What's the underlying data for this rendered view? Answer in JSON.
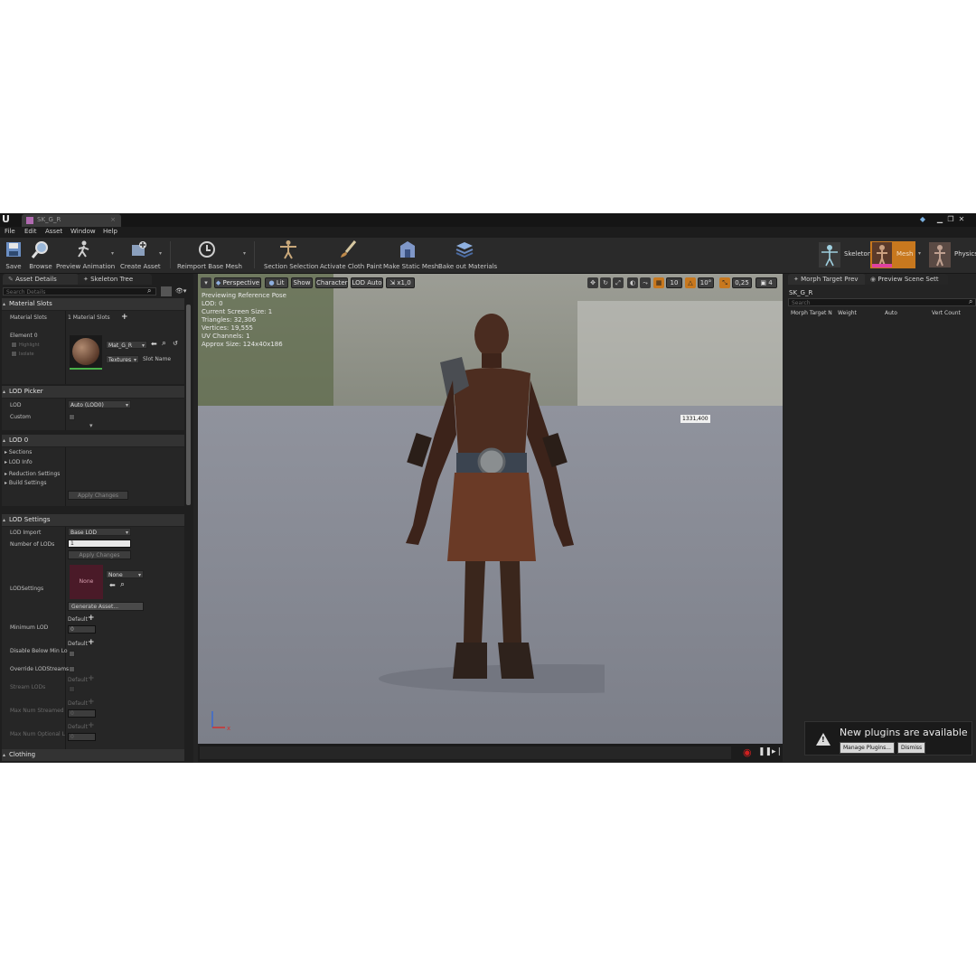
{
  "window": {
    "tab_title": "SK_G_R"
  },
  "menu": [
    "File",
    "Edit",
    "Asset",
    "Window",
    "Help"
  ],
  "toolbar": {
    "save": "Save",
    "browse": "Browse",
    "preview_animation": "Preview Animation",
    "create_asset": "Create Asset",
    "reimport_base_mesh": "Reimport Base Mesh",
    "section_selection": "Section Selection",
    "activate_cloth_paint": "Activate Cloth Paint",
    "make_static_mesh": "Make Static Mesh",
    "bake_out_materials": "Bake out Materials",
    "modes": {
      "skeleton": "Skeleton",
      "mesh": "Mesh",
      "physics": "Physics"
    }
  },
  "left_panel": {
    "tabs": {
      "asset_details": "Asset Details",
      "skeleton_tree": "Skeleton Tree"
    },
    "search_placeholder": "Search Details",
    "material_slots": {
      "header": "Material Slots",
      "label": "Material Slots",
      "count": "1 Material Slots",
      "element": "Element 0",
      "highlight": "Highlight",
      "isolate": "Isolate",
      "material": "Mat_G_R",
      "textures": "Textures",
      "slot_name": "Slot Name"
    },
    "lod_picker": {
      "header": "LOD Picker",
      "lod_label": "LOD",
      "lod_value": "Auto (LOD0)",
      "custom": "Custom"
    },
    "lod0": {
      "header": "LOD 0",
      "sections": "Sections",
      "lod_info": "LOD Info",
      "reduction_settings": "Reduction Settings",
      "build_settings": "Build Settings",
      "apply_changes": "Apply Changes"
    },
    "lod_settings": {
      "header": "LOD Settings",
      "lod_import": "LOD Import",
      "lod_import_value": "Base LOD",
      "number_of_lods": "Number of LODs",
      "number_of_lods_value": "1",
      "apply_changes": "Apply Changes",
      "lodsettings": "LODSettings",
      "thumb": "None",
      "asset_value": "None",
      "generate_asset": "Generate Asset...",
      "minimum_lod": "Minimum LOD",
      "default": "Default",
      "zero": "0",
      "disable_below_min": "Disable Below Min Lo",
      "override_lodstreams": "Override LODStreams",
      "stream_lods": "Stream LODs",
      "max_num_streamed": "Max Num Streamed",
      "max_num_optional": "Max Num Optional L"
    },
    "clothing": "Clothing"
  },
  "viewport": {
    "perspective": "Perspective",
    "lit": "Lit",
    "show": "Show",
    "character": "Character",
    "lod_auto": "LOD Auto",
    "speed": "x1,0",
    "snap_grid": "10",
    "snap_rot": "10°",
    "snap_scale": "0,25",
    "cam_speed": "4",
    "info": [
      "Previewing Reference Pose",
      "LOD: 0",
      "Current Screen Size: 1",
      "Triangles: 32,306",
      "Vertices: 19,555",
      "UV Channels: 1",
      "Approx Size: 124x40x186"
    ],
    "coord_badge": "1331,400"
  },
  "right_panel": {
    "tabs": {
      "morph": "Morph Target Prev",
      "scene": "Preview Scene Sett"
    },
    "asset": "SK_G_R",
    "search_placeholder": "Search",
    "columns": [
      "Morph Target N",
      "Weight",
      "Auto",
      "Vert Count"
    ]
  },
  "notification": {
    "title": "New plugins are available",
    "manage": "Manage Plugins...",
    "dismiss": "Dismiss"
  }
}
